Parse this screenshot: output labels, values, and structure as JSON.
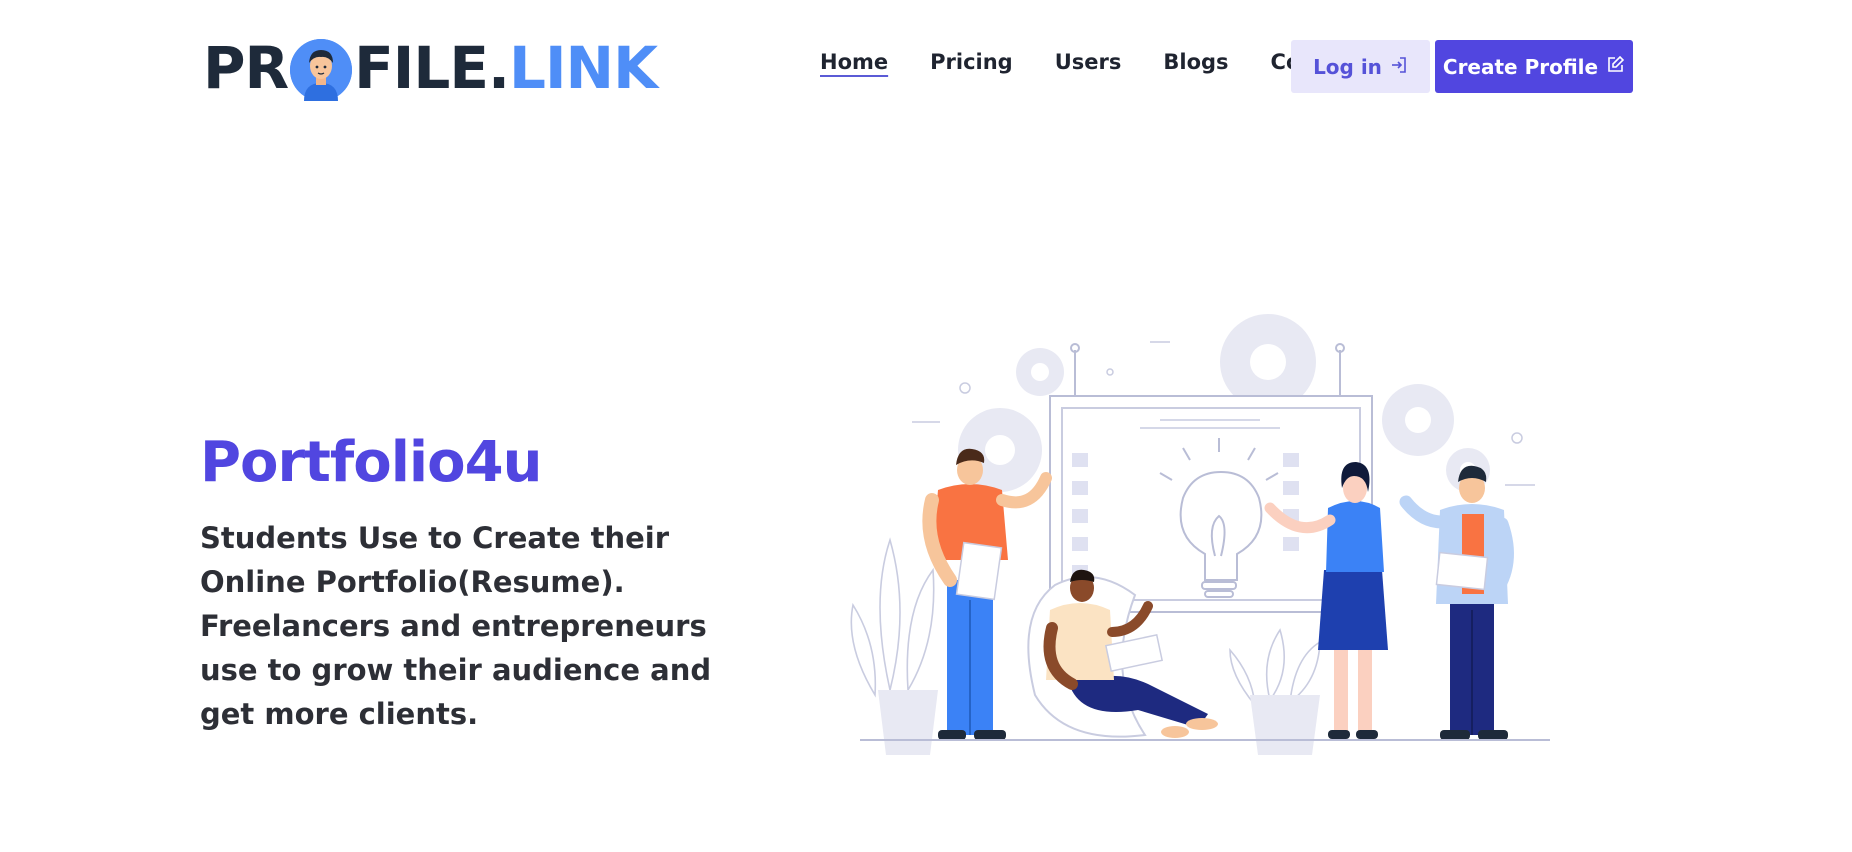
{
  "brand": {
    "logo_part1": "PR",
    "logo_part2": "FILE",
    "logo_dot": ".",
    "logo_part3": "LINK"
  },
  "nav": {
    "items": [
      {
        "label": "Home",
        "active": true
      },
      {
        "label": "Pricing",
        "active": false
      },
      {
        "label": "Users",
        "active": false
      },
      {
        "label": "Blogs",
        "active": false
      },
      {
        "label": "Contact",
        "active": false
      }
    ],
    "login_label": "Log in",
    "create_label": "Create Profile"
  },
  "hero": {
    "title": "Portfolio4u",
    "description": "Students Use to Create their Online Portfolio(Resume). Freelancers and entrepreneurs use to grow their audience and get more clients."
  },
  "colors": {
    "accent": "#5146e0",
    "login_bg": "#e8e6fb",
    "logo_dark": "#1e2a3a",
    "logo_blue": "#4f8ef7"
  },
  "icons": {
    "login": "login-icon",
    "create": "edit-icon"
  }
}
